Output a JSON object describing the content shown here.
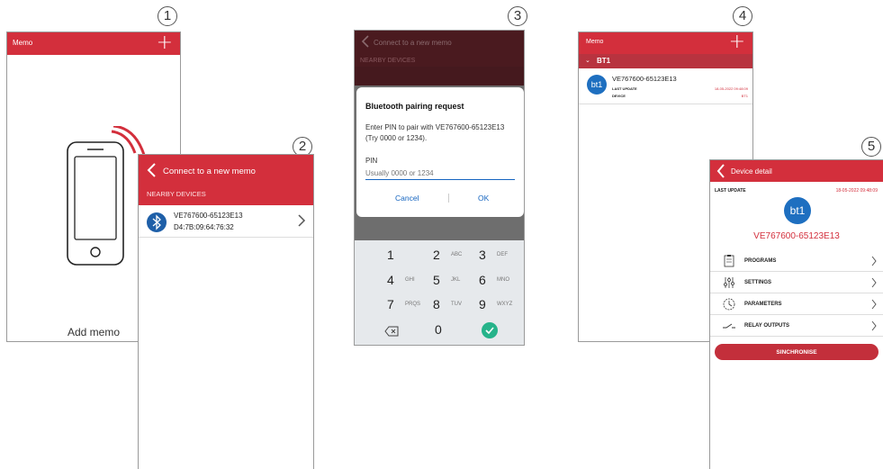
{
  "steps": [
    "1",
    "2",
    "3",
    "4",
    "5"
  ],
  "screen1": {
    "title": "Memo",
    "add_memo": "Add memo"
  },
  "screen2": {
    "title": "Connect to a new memo",
    "section": "NEARBY DEVICES",
    "device": {
      "name": "VE767600-65123E13",
      "address": "D4:7B:09:64:76:32"
    }
  },
  "screen3": {
    "title": "Connect to a new memo",
    "section": "NEARBY DEVICES",
    "dialog": {
      "title": "Bluetooth pairing request",
      "body": "Enter PIN to pair with VE767600-65123E13 (Try 0000 or 1234).",
      "pin_label": "PIN",
      "pin_placeholder": "Usually 0000 or 1234",
      "cancel": "Cancel",
      "ok": "OK"
    },
    "keypad": [
      {
        "n": "1",
        "l": ""
      },
      {
        "n": "2",
        "l": "ABC"
      },
      {
        "n": "3",
        "l": "DEF"
      },
      {
        "n": "4",
        "l": "GHI"
      },
      {
        "n": "5",
        "l": "JKL"
      },
      {
        "n": "6",
        "l": "MNO"
      },
      {
        "n": "7",
        "l": "PRQS"
      },
      {
        "n": "8",
        "l": "TUV"
      },
      {
        "n": "9",
        "l": "WXYZ"
      },
      {
        "n": "",
        "l": ""
      },
      {
        "n": "0",
        "l": ""
      },
      {
        "n": "",
        "l": ""
      }
    ]
  },
  "screen4": {
    "title": "Memo",
    "group": "BT1",
    "memo": {
      "avatar": "bt1",
      "name": "VE767600-65123E13",
      "last_update_label": "LAST UPDATE",
      "last_update": "18-05-2022 09:48:09",
      "device_label": "DEVICE",
      "device": "BT1"
    }
  },
  "screen5": {
    "title": "Device detail",
    "last_update_label": "LAST UPDATE",
    "last_update": "18-05-2022 09:48:09",
    "avatar": "bt1",
    "device_name": "VE767600-65123E13",
    "menu": [
      "PROGRAMS",
      "SETTINGS",
      "PARAMETERS",
      "RELAY OUTPUTS"
    ],
    "sync_button": "SINCHRONISE"
  },
  "colors": {
    "brand_red": "#d32f3c",
    "bluetooth_blue": "#1e5fa8",
    "confirm_green": "#26b38a",
    "link_blue": "#1565c0"
  },
  "icons": [
    "plus-icon",
    "phone-illustration",
    "wifi-signal-icon",
    "back-chevron-icon",
    "bluetooth-icon",
    "chevron-right-icon",
    "backspace-icon",
    "check-icon",
    "expand-chevron-icon",
    "clipboard-icon",
    "sliders-icon",
    "clock-icon",
    "relay-switch-icon"
  ]
}
